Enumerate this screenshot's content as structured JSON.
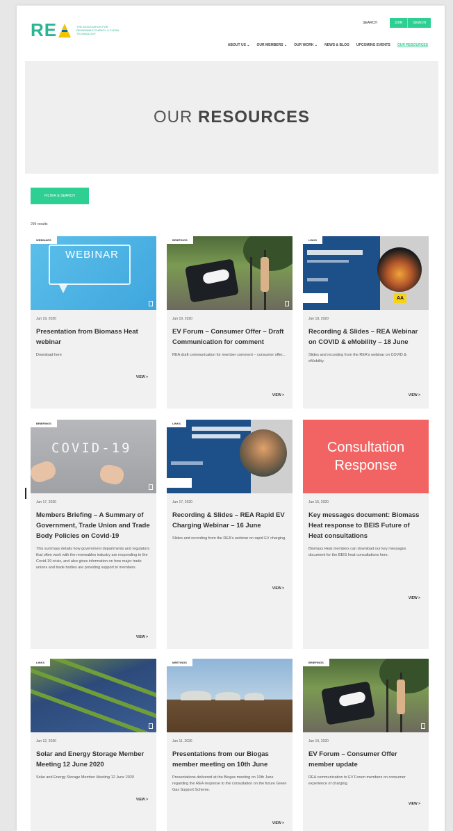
{
  "header": {
    "logo_text": "RE",
    "logo_tagline": "THE ASSOCIATION FOR RENEWABLE ENERGY & CLEAN TECHNOLOGY",
    "search_label": "SEARCH",
    "join_label": "JOIN",
    "signin_label": "SIGN IN",
    "nav": [
      "ABOUT US ⌄",
      "OUR MEMBERS ⌄",
      "OUR WORK ⌄",
      "NEWS & BLOG",
      "UPCOMING EVENTS",
      "OUR RESOURCES"
    ]
  },
  "hero": {
    "title_light": "OUR ",
    "title_bold": "RESOURCES"
  },
  "filter_button": "FILTER & SEARCH",
  "results_count": "299 results",
  "cards": [
    {
      "tag": "WEBINARS",
      "thumb_text": "WEBINAR",
      "date": "Jun 19, 2020",
      "title": "Presentation from Biomass Heat webinar",
      "excerpt": "Download here",
      "view": "VIEW >"
    },
    {
      "tag": "BRIEFINGS",
      "date": "Jun 19, 2020",
      "title": "EV Forum – Consumer Offer – Draft Communication for comment",
      "excerpt": "REA draft communication for member comment – consumer offer...",
      "view": "VIEW >"
    },
    {
      "tag": "LINKS",
      "thumb_text": "AA",
      "date": "Jun 18, 2020",
      "title": "Recording & Slides – REA Webinar on COVID & eMobility – 18 June",
      "excerpt": "Slides and recording from the REA's webinar on COVID & eMobility.",
      "view": "VIEW >"
    },
    {
      "tag": "BRIEFINGS",
      "thumb_text": "COVID-19",
      "date": "Jun 17, 2020",
      "title": "Members Briefing – A Summary of Government, Trade Union and Trade Body Policies on Covid-19",
      "excerpt": "This summary details how government departments and regulators that often work with the renewables industry are responding to the Covid-19 crisis, and also gives information on how major trade unions and trade bodies are providing support to members.",
      "view": "VIEW >"
    },
    {
      "tag": "LINKS",
      "date": "Jun 17, 2020",
      "title": "Recording & Slides – REA Rapid EV Charging Webinar – 16 June",
      "excerpt": "Slides and recording from the REA's webinar on rapid EV charging.",
      "view": "VIEW >"
    },
    {
      "tag": "",
      "thumb_text_1": "Consultation",
      "thumb_text_2": "Response",
      "date": "Jun 16, 2020",
      "title": "Key messages document: Biomass Heat response to BEIS Future of Heat consultations",
      "excerpt": "Biomass Heat members can download our key messages document for the BEIS heat consultations here.",
      "view": "VIEW >"
    },
    {
      "tag": "LINKS",
      "date": "Jun 12, 2020",
      "title": "Solar and Energy Storage Member Meeting 12 June 2020",
      "excerpt": "Solar and Energy Storage Member Meeting 12 June 2020",
      "view": "VIEW >"
    },
    {
      "tag": "MEETINGS",
      "date": "Jun 11, 2020",
      "title": "Presentations from our Biogas member meeting on 10th June",
      "excerpt": "Presentations delivered at the Biogas meeting on 10th June regarding the REA response to the consultation on the future Green Gas Support Scheme.",
      "view": "VIEW >"
    },
    {
      "tag": "BRIEFINGS",
      "date": "Jun 10, 2020",
      "title": "EV Forum – Consumer Offer member update",
      "excerpt": "REA communication to EV Forum members on consumer experience of charging.",
      "view": "VIEW >"
    }
  ],
  "colors": {
    "brand_green": "#2ecf93",
    "logo_green": "#2bb592",
    "consultation_red": "#f16463",
    "card_bg": "#f1f1f1",
    "hero_bg": "#efefef"
  }
}
